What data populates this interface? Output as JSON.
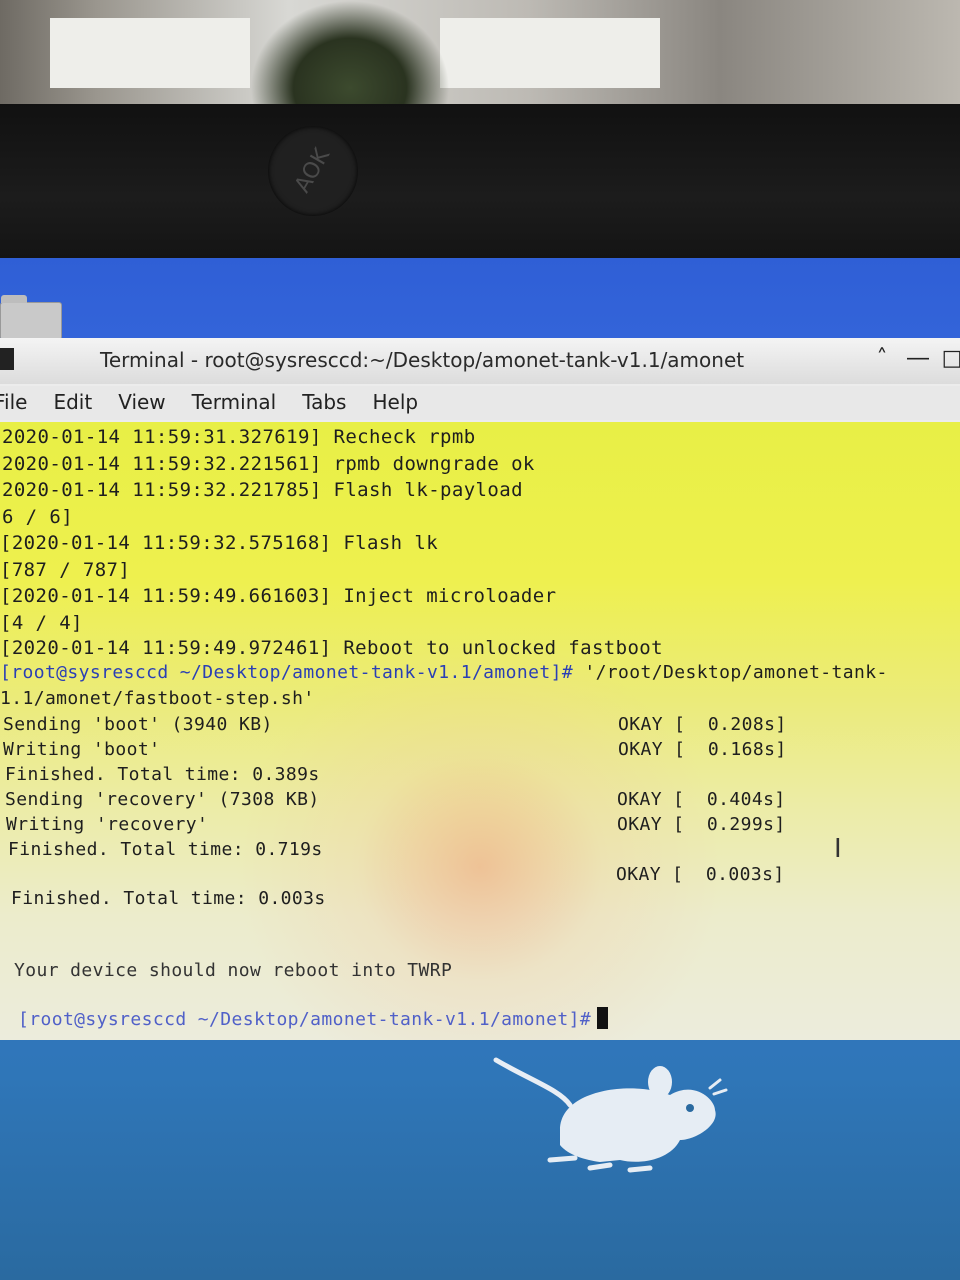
{
  "window": {
    "title": "Terminal - root@sysresccd:~/Desktop/amonet-tank-v1.1/amonet",
    "buttons": {
      "minimize": "˄",
      "maximize": "―",
      "close": "□"
    }
  },
  "bezel_logo": "AOK",
  "menu": [
    "File",
    "Edit",
    "View",
    "Terminal",
    "Tabs",
    "Help"
  ],
  "terminal_lines": [
    "2020-01-14 11:59:31.327619] Recheck rpmb",
    "2020-01-14 11:59:32.221561] rpmb downgrade ok",
    "2020-01-14 11:59:32.221785] Flash lk-payload",
    "6 / 6]",
    "[2020-01-14 11:59:32.575168] Flash lk",
    "[787 / 787]",
    "[2020-01-14 11:59:49.661603] Inject microloader",
    "[4 / 4]",
    "[2020-01-14 11:59:49.972461] Reboot to unlocked fastboot"
  ],
  "prompt1": "[root@sysresccd ~/Desktop/amonet-tank-v1.1/amonet]#",
  "command1": " '/root/Desktop/amonet-tank-",
  "command1_cont": "1.1/amonet/fastboot-step.sh'",
  "fastboot_lines": [
    "Sending 'boot' (3940 KB)",
    "Writing 'boot'",
    "Finished. Total time: 0.389s",
    "Sending 'recovery' (7308 KB)",
    "Writing 'recovery'",
    "Finished. Total time: 0.719s",
    "",
    "Finished. Total time: 0.003s"
  ],
  "okay_lines": [
    "OKAY [  0.208s]",
    "OKAY [  0.168s]",
    "OKAY [  0.404s]",
    "OKAY [  0.299s]",
    "OKAY [  0.003s]"
  ],
  "message": "Your device should now reboot into TWRP",
  "prompt2": "[root@sysresccd ~/Desktop/amonet-tank-v1.1/amonet]#",
  "colors": {
    "prompt": "#2a3fb5",
    "desktop": "#2f5fd6",
    "terminal_bg": "#e8ef46"
  }
}
